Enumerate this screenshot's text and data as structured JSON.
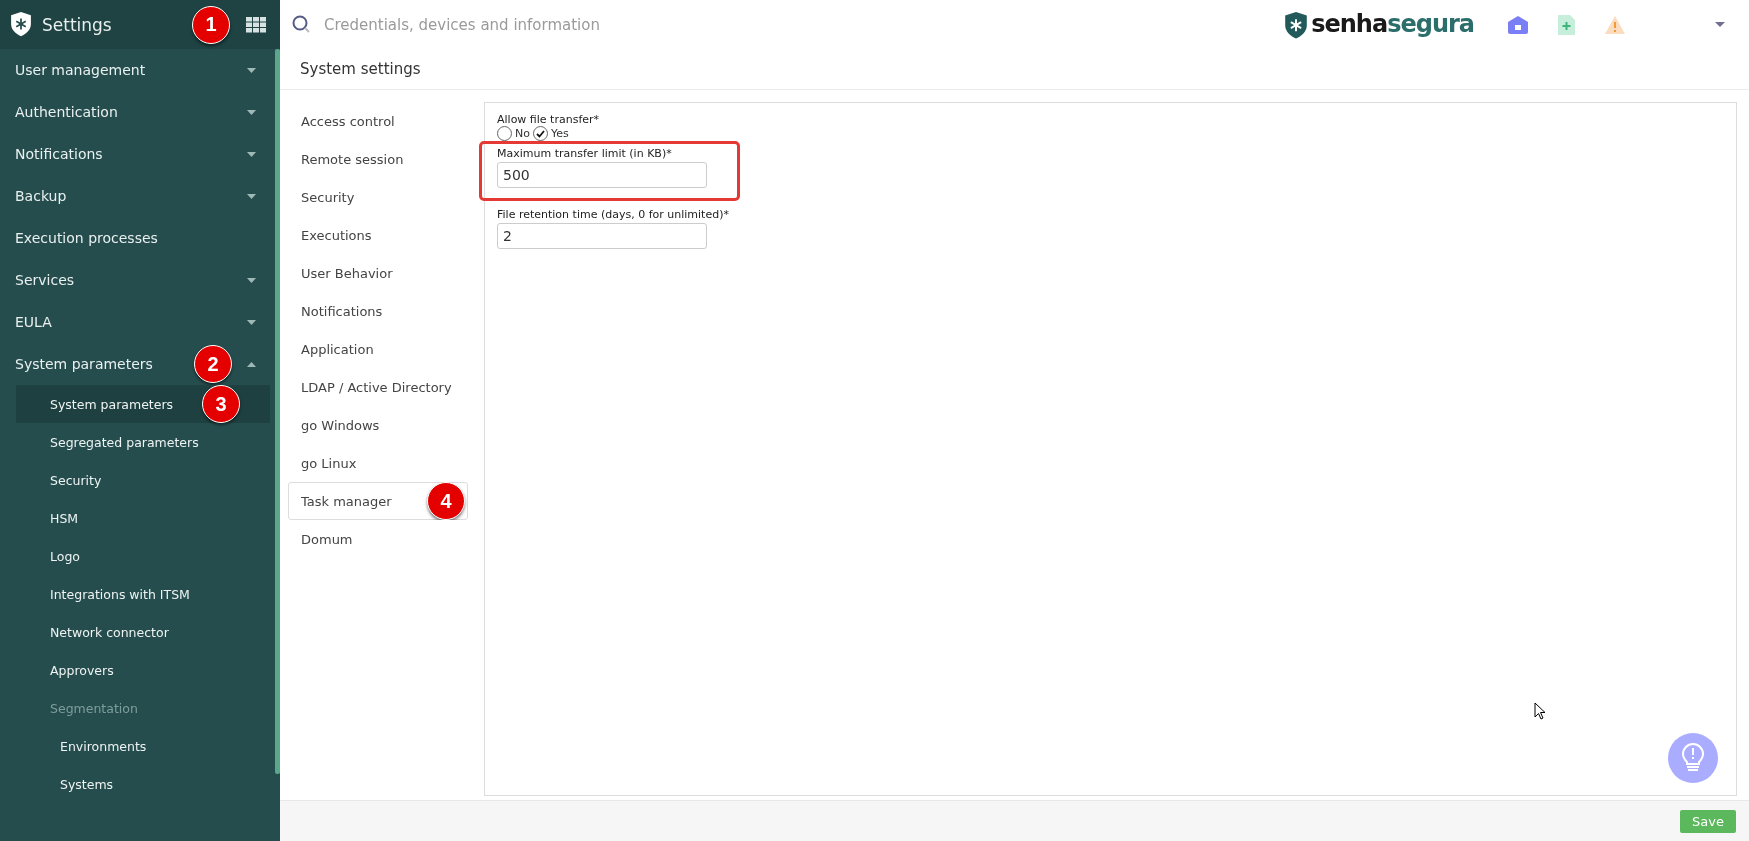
{
  "sidebar": {
    "title": "Settings",
    "badge": "1",
    "items": [
      {
        "label": "User management",
        "expanded": false
      },
      {
        "label": "Authentication",
        "expanded": false
      },
      {
        "label": "Notifications",
        "expanded": false
      },
      {
        "label": "Backup",
        "expanded": false
      },
      {
        "label": "Execution processes"
      },
      {
        "label": "Services",
        "expanded": false
      },
      {
        "label": "EULA",
        "expanded": false
      },
      {
        "label": "System parameters",
        "expanded": true,
        "badge": "2",
        "children": [
          {
            "label": "System parameters",
            "selected": true,
            "disabled": false,
            "badge": "3"
          },
          {
            "label": "Segregated parameters",
            "selected": false,
            "disabled": false
          },
          {
            "label": "Security",
            "selected": false,
            "disabled": false
          },
          {
            "label": "HSM",
            "selected": false,
            "disabled": false
          },
          {
            "label": "Logo",
            "selected": false,
            "disabled": false
          },
          {
            "label": "Integrations with ITSM",
            "selected": false,
            "disabled": false
          },
          {
            "label": "Network connector",
            "selected": false,
            "disabled": false
          },
          {
            "label": "Approvers",
            "selected": false,
            "disabled": false
          },
          {
            "label": "Segmentation",
            "selected": false,
            "disabled": true,
            "children": [
              {
                "label": "Environments",
                "selected": false,
                "disabled": false
              },
              {
                "label": "Systems",
                "selected": false,
                "disabled": false
              }
            ]
          }
        ]
      }
    ]
  },
  "topbar": {
    "search": {
      "placeholder": "Credentials, devices and information"
    },
    "logo": {
      "part_1": "senha",
      "part_2": "segura"
    }
  },
  "page": {
    "title": "System settings",
    "tabs": [
      {
        "label": "Access control",
        "selected": false
      },
      {
        "label": "Remote session",
        "selected": false
      },
      {
        "label": "Security",
        "selected": false
      },
      {
        "label": "Executions",
        "selected": false
      },
      {
        "label": "User Behavior",
        "selected": false
      },
      {
        "label": "Notifications",
        "selected": false
      },
      {
        "label": "Application",
        "selected": false
      },
      {
        "label": "LDAP / Active Directory",
        "selected": false
      },
      {
        "label": "go Windows",
        "selected": false
      },
      {
        "label": "go Linux",
        "selected": false
      },
      {
        "label": "Task manager",
        "selected": true,
        "badge": "4"
      },
      {
        "label": "Domum",
        "selected": false
      }
    ],
    "form": [
      {
        "kind": "radio",
        "label": "Allow file transfer*",
        "options": [
          {
            "label": "No",
            "selected": false
          },
          {
            "label": "Yes",
            "selected": true
          }
        ]
      },
      {
        "kind": "input",
        "label": "Maximum transfer limit (in KB)*",
        "value": "500",
        "highlighted": true
      },
      {
        "kind": "input",
        "label": "File retention time (days, 0 for unlimited)*",
        "value": "2",
        "highlighted": false
      }
    ]
  },
  "footer": {
    "save": "Save"
  }
}
